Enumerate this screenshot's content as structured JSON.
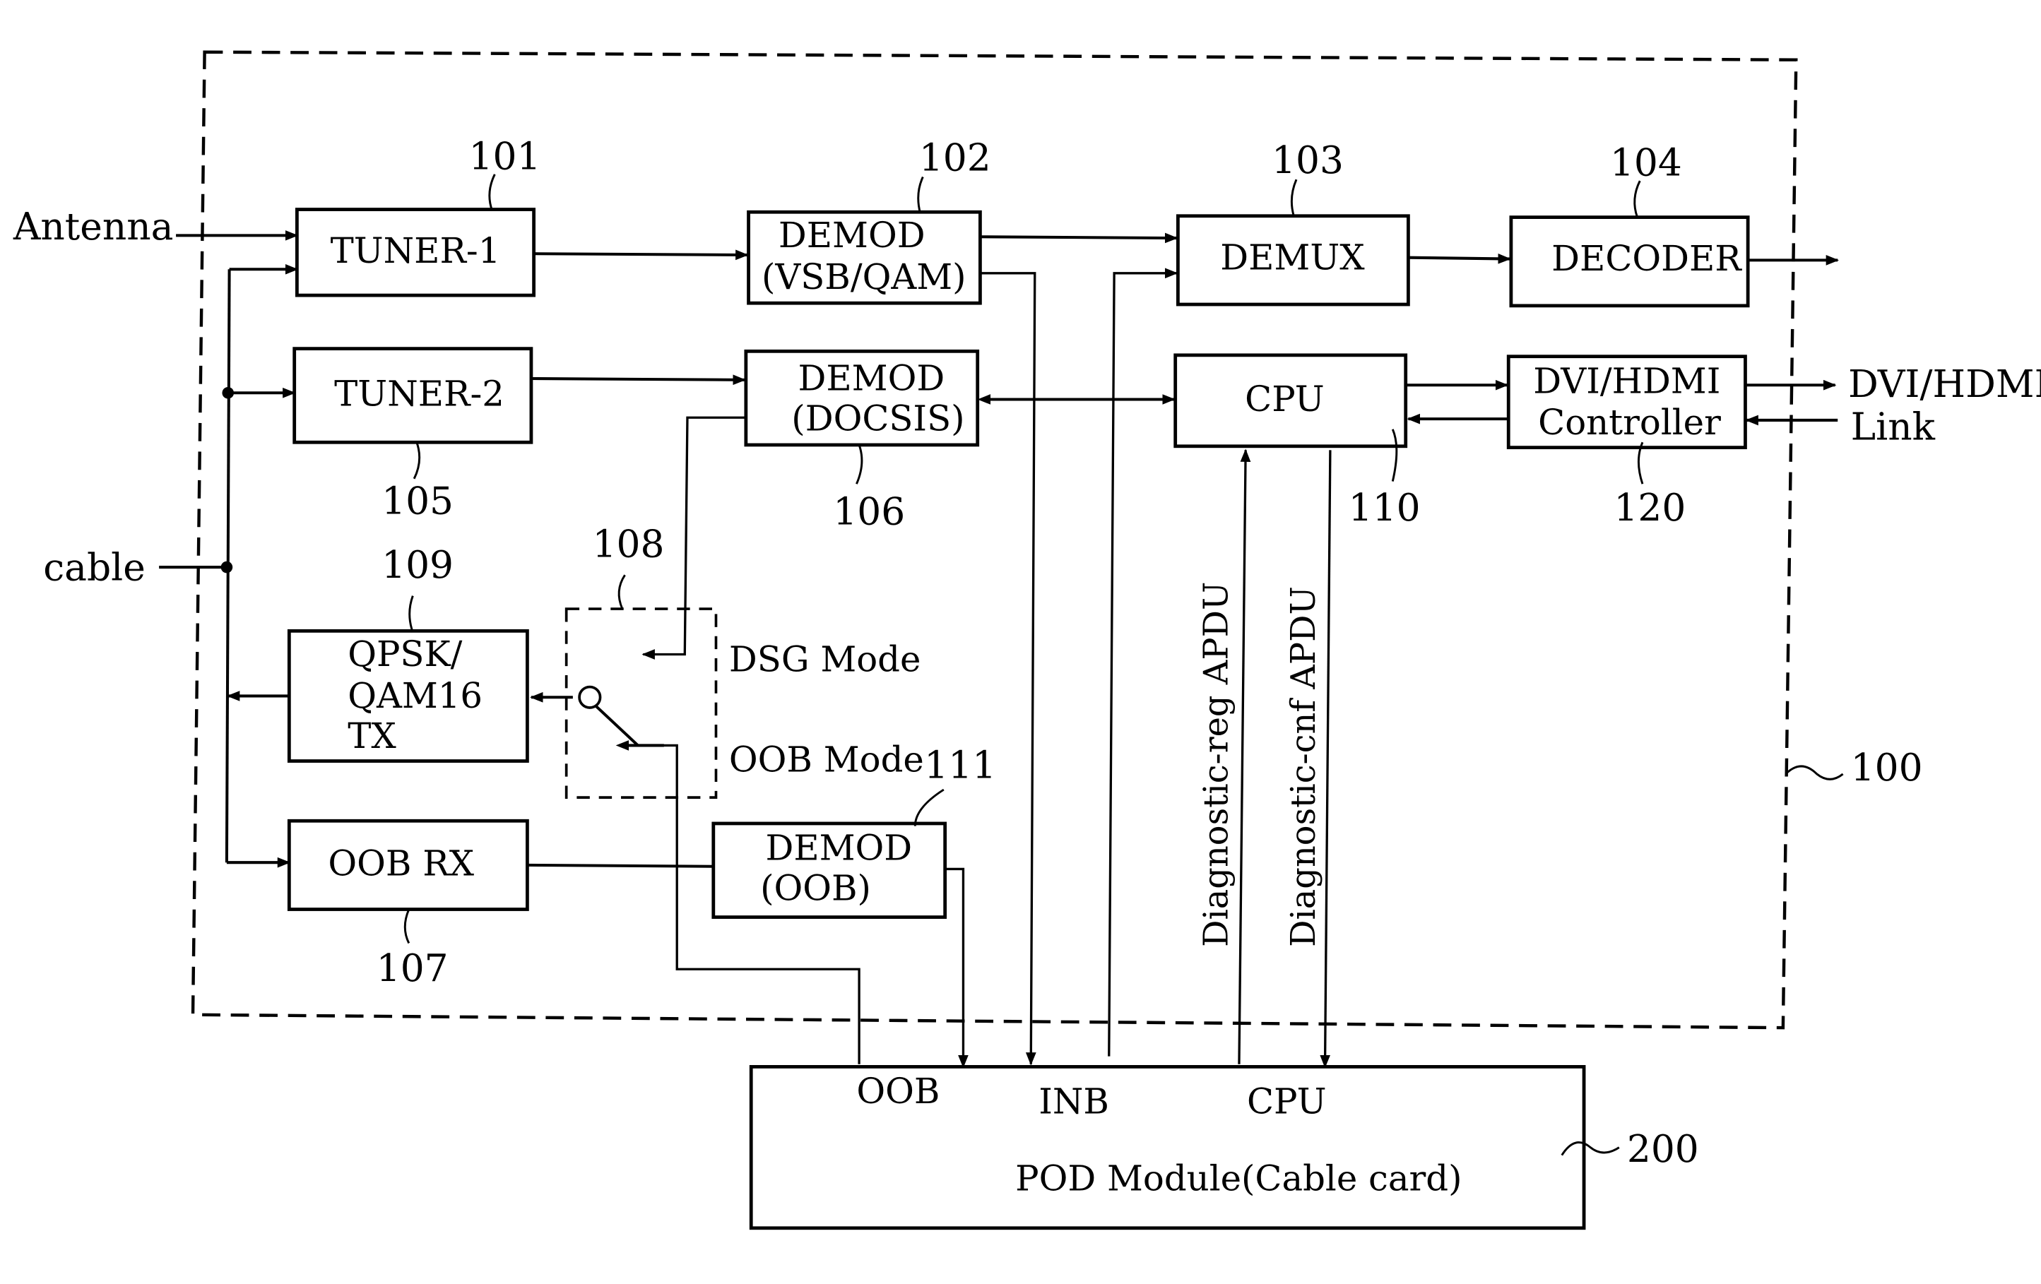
{
  "figure": {
    "system_ref": "100",
    "pod_ref": "200",
    "inputs": {
      "antenna": "Antenna",
      "cable": "cable"
    },
    "outputs": {
      "dvi_hdmi_line1": "DVI/HDMI",
      "dvi_hdmi_line2": "Link"
    },
    "blocks": {
      "tuner1": {
        "label": "TUNER-1",
        "ref": "101"
      },
      "demod_vsb": {
        "line1": "DEMOD",
        "line2": "(VSB/QAM)",
        "ref": "102"
      },
      "demux": {
        "label": "DEMUX",
        "ref": "103"
      },
      "decoder": {
        "label": "DECODER",
        "ref": "104"
      },
      "tuner2": {
        "label": "TUNER-2",
        "ref": "105"
      },
      "demod_docsis": {
        "line1": "DEMOD",
        "line2": "(DOCSIS)",
        "ref": "106"
      },
      "oob_rx": {
        "label": "OOB RX",
        "ref": "107"
      },
      "switch": {
        "ref": "108",
        "mode_dsg": "DSG Mode",
        "mode_oob": "OOB Mode"
      },
      "qpsk_tx": {
        "line1": "QPSK/",
        "line2": "QAM16",
        "line3": "TX",
        "ref": "109"
      },
      "cpu": {
        "label": "CPU",
        "ref": "110"
      },
      "demod_oob": {
        "line1": "DEMOD",
        "line2": "(OOB)",
        "ref": "111"
      },
      "dvi_ctrl": {
        "line1": "DVI/HDMI",
        "line2": "Controller",
        "ref": "120"
      }
    },
    "signals": {
      "diag_req": "Diagnostic-reg APDU",
      "diag_cnf": "Diagnostic-cnf APDU"
    },
    "pod": {
      "label": "POD Module(Cable card)",
      "port_oob": "OOB",
      "port_inb": "INB",
      "port_cpu": "CPU"
    }
  }
}
